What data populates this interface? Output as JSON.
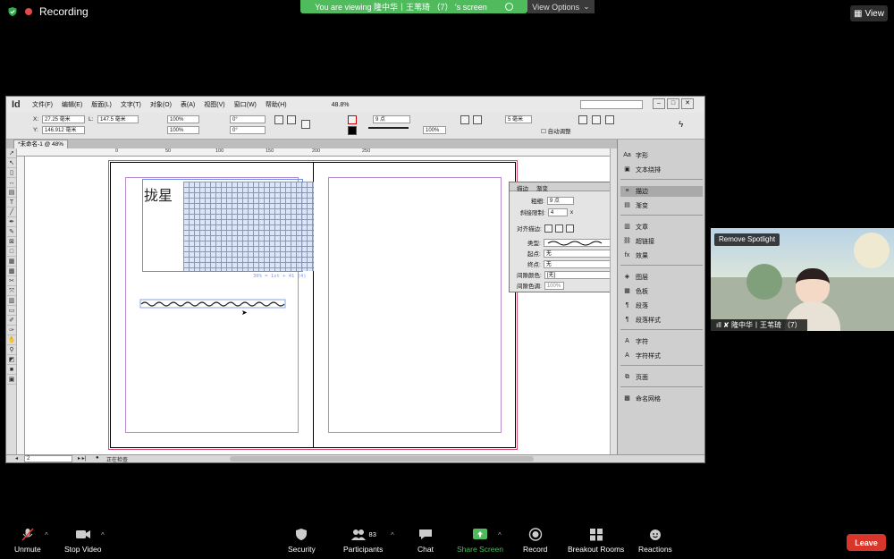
{
  "zoom": {
    "recording_label": "Recording",
    "viewing_banner": "You are viewing 隆中华丨王苇琦 （7） 's screen",
    "view_options": "View Options",
    "view_button": "View",
    "remove_spotlight": "Remove Spotlight",
    "participant_name": "隆中华丨王苇琦 （7）",
    "participants_count": "83",
    "toolbar": {
      "unmute": "Unmute",
      "stop_video": "Stop Video",
      "security": "Security",
      "participants": "Participants",
      "chat": "Chat",
      "share_screen": "Share Screen",
      "record": "Record",
      "breakout_rooms": "Breakout Rooms",
      "reactions": "Reactions",
      "leave": "Leave"
    },
    "colors": {
      "share_green": "#4fbb5d",
      "leave_red": "#d8362a",
      "recording_red": "#e4484a"
    }
  },
  "indesign": {
    "logo": "Id",
    "menu": [
      "文件(F)",
      "编辑(E)",
      "版面(L)",
      "文字(T)",
      "对象(O)",
      "表(A)",
      "视图(V)",
      "窗口(W)",
      "帮助(H)"
    ],
    "zoom_level": "48.8%",
    "control": {
      "x": "27.25 毫米",
      "y": "146.912 毫米",
      "l": "147.5 毫米",
      "scale1": "100%",
      "scale2": "100%",
      "angle1": "0°",
      "angle2": "0°",
      "stroke_weight": "9 点",
      "opacity": "100%",
      "pt5": "5 毫米",
      "autofit": "自动调整"
    },
    "doc_tab": "*未命名-1 @ 48%",
    "ruler_ticks": [
      "0",
      "50",
      "100",
      "150",
      "200",
      "250",
      "0",
      "50",
      "100",
      "150",
      "200",
      "250",
      "300"
    ],
    "canvas_text": "拢星",
    "canvas_formula": "30% = 1st  + 41 (4)",
    "stroke_panel": {
      "tab1": "描边",
      "tab2": "渐变",
      "weight_label": "粗细:",
      "weight_value": "9 点",
      "miter_label": "斜接限制:",
      "miter_value": "4",
      "miter_x": "x",
      "align_label": "对齐描边:",
      "type_label": "类型:",
      "start_label": "起点:",
      "start_value": "无",
      "end_label": "终点:",
      "end_value": "无",
      "gap_color_label": "间隙颜色:",
      "gap_color_value": "[无]",
      "gap_tint_label": "间隙色调:",
      "gap_tint_value": "100%"
    },
    "dock_items": [
      "字形",
      "文本绕排",
      "描边",
      "渐变",
      "文章",
      "超链接",
      "效果",
      "图层",
      "色板",
      "段落",
      "段落样式",
      "字符",
      "字符样式",
      "页面",
      "命名网格"
    ],
    "status": {
      "page": "2",
      "preflight": "正在检查"
    }
  }
}
